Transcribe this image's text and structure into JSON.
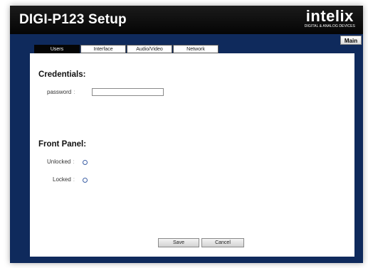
{
  "app": {
    "title": "DIGI-P123 Setup",
    "logo_word": "intelix",
    "logo_tagline": "DIGITAL & ANALOG DEVICES"
  },
  "nav": {
    "main_label": "Main"
  },
  "tabs": [
    {
      "label": "Users",
      "active": true
    },
    {
      "label": "Interface",
      "active": false
    },
    {
      "label": "Audio/Video",
      "active": false
    },
    {
      "label": "Network",
      "active": false
    }
  ],
  "credentials": {
    "title": "Credentials:",
    "password_label": "password",
    "password_value": ""
  },
  "front_panel": {
    "title": "Front Panel:",
    "unlocked_label": "Unlocked",
    "locked_label": "Locked"
  },
  "actions": {
    "save_label": "Save",
    "cancel_label": "Cancel"
  },
  "colors": {
    "frame_background": "#0f2a5c",
    "header_background": "#111111",
    "active_tab": "#050505"
  }
}
